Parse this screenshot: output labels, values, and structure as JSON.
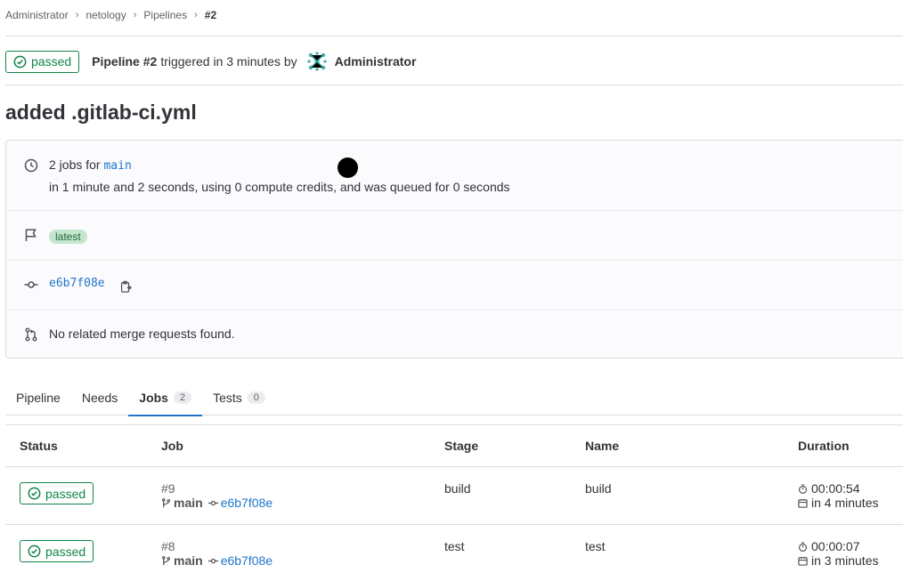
{
  "breadcrumb": [
    "Administrator",
    "netology",
    "Pipelines",
    "#2"
  ],
  "header": {
    "status": "passed",
    "pipeline_label": "Pipeline #2",
    "triggered_text": "triggered in 3 minutes by",
    "user": "Administrator"
  },
  "title": "added .gitlab-ci.yml",
  "info": {
    "jobs_text": "2 jobs for",
    "ref": "main",
    "duration_text": "in 1 minute and 2 seconds, using 0 compute credits, and was queued for 0 seconds",
    "label": "latest",
    "commit_sha": "e6b7f08e",
    "merge_requests_text": "No related merge requests found."
  },
  "tabs": [
    {
      "label": "Pipeline",
      "count": null
    },
    {
      "label": "Needs",
      "count": null
    },
    {
      "label": "Jobs",
      "count": "2"
    },
    {
      "label": "Tests",
      "count": "0"
    }
  ],
  "table": {
    "headers": [
      "Status",
      "Job",
      "Stage",
      "Name",
      "Duration"
    ],
    "rows": [
      {
        "status": "passed",
        "job_id": "#9",
        "branch": "main",
        "sha": "e6b7f08e",
        "stage": "build",
        "name": "build",
        "duration": "00:00:54",
        "finished": "in 4 minutes"
      },
      {
        "status": "passed",
        "job_id": "#8",
        "branch": "main",
        "sha": "e6b7f08e",
        "stage": "test",
        "name": "test",
        "duration": "00:00:07",
        "finished": "in 3 minutes"
      }
    ]
  },
  "colors": {
    "success": "#108548",
    "link": "#1f75cb",
    "latest_bg": "#c3e6cd"
  }
}
